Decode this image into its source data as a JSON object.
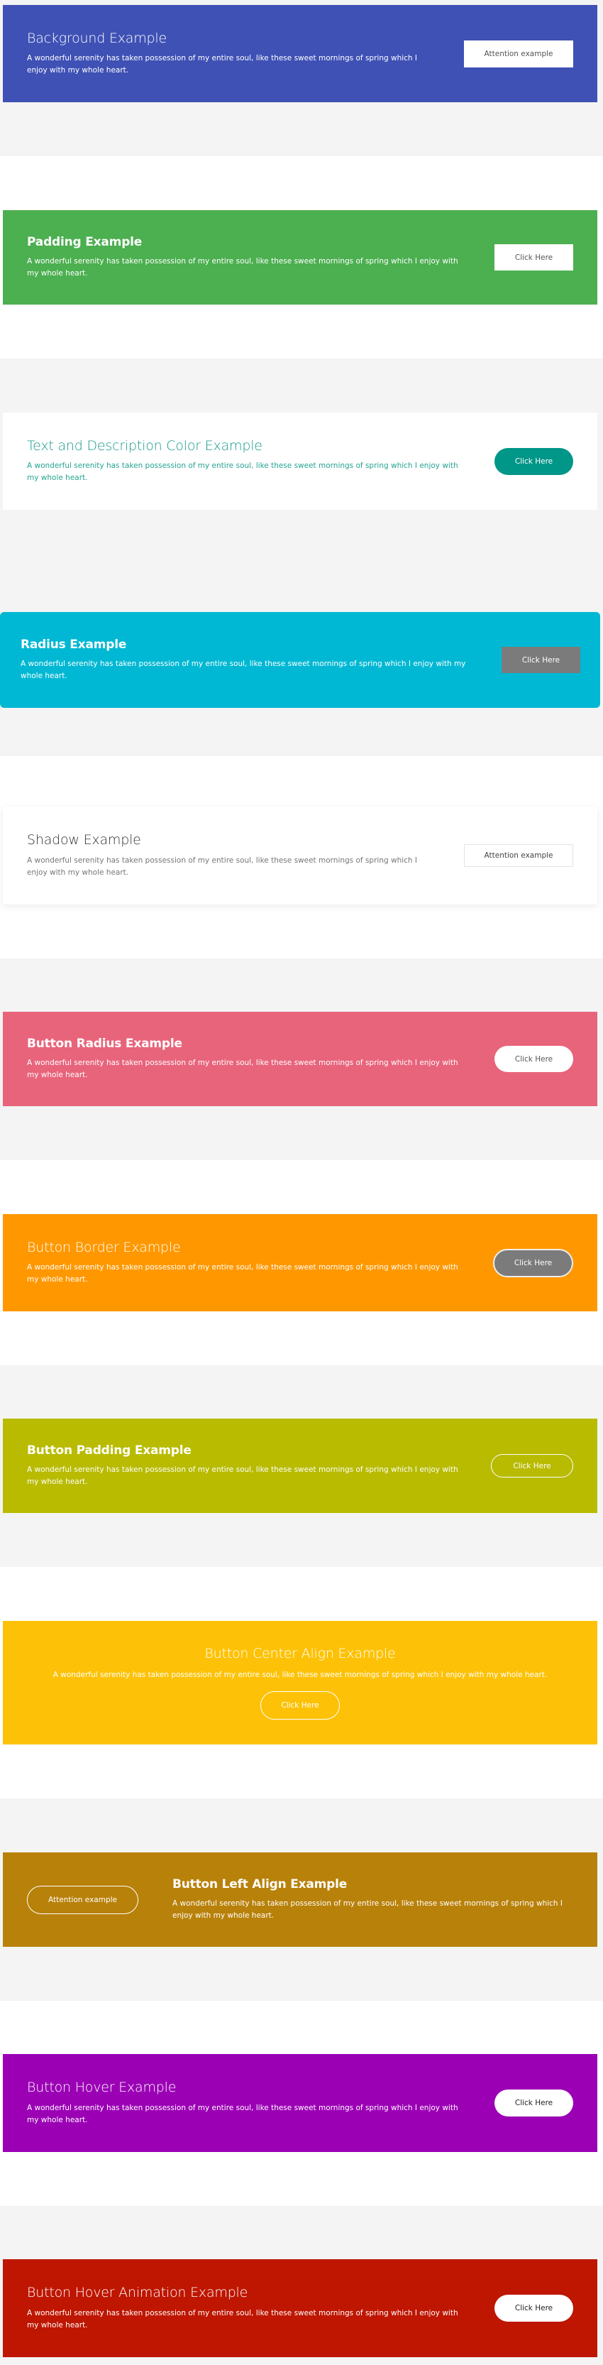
{
  "colors": {
    "page_gray": "#f4f4f4",
    "page_white": "#ffffff"
  },
  "sections": [
    {
      "title": "Background Example",
      "description": "A wonderful serenity has taken possession of my entire soul, like these sweet mornings of spring which I enjoy with my whole heart.",
      "button": "Attention example",
      "bg_color": "#3f51b5"
    },
    {
      "title": "Padding Example",
      "description": "A wonderful serenity has taken possession of my entire soul, like these sweet mornings of spring which I enjoy with my whole heart.",
      "button": "Click Here",
      "bg_color": "#4caf50"
    },
    {
      "title": "Text and Description Color Example",
      "description": "A wonderful serenity has taken possession of my entire soul, like these sweet mornings of spring which I enjoy with my whole heart.",
      "button": "Click Here",
      "bg_color": "#ffffff",
      "text_color": "#179a8a",
      "button_color": "#009688"
    },
    {
      "title": "Radius Example",
      "description": "A wonderful serenity has taken possession of my entire soul, like these sweet mornings of spring which I enjoy with my whole heart.",
      "button": "Click Here",
      "bg_color": "#00b8d4",
      "button_color": "#7b7b7b"
    },
    {
      "title": "Shadow Example",
      "description": "A wonderful serenity has taken possession of my entire soul, like these sweet mornings of spring which I enjoy with my whole heart.",
      "button": "Attention example",
      "bg_color": "#ffffff"
    },
    {
      "title": "Button Radius Example",
      "description": "A wonderful serenity has taken possession of my entire soul, like these sweet mornings of spring which I enjoy with my whole heart.",
      "button": "Click Here",
      "bg_color": "#e8647b"
    },
    {
      "title": "Button Border Example",
      "description": "A wonderful serenity has taken possession of my entire soul, like these sweet mornings of spring which I enjoy with my whole heart.",
      "button": "Click Here",
      "bg_color": "#ff9800",
      "button_color": "#7b7b7b"
    },
    {
      "title": "Button Padding Example",
      "description": "A wonderful serenity has taken possession of my entire soul, like these sweet mornings of spring which I enjoy with my whole heart.",
      "button": "Click Here",
      "bg_color": "#b8bb00"
    },
    {
      "title": "Button Center Align Example",
      "description": "A wonderful serenity has taken possession of my entire soul, like these sweet mornings of spring which I enjoy with my whole heart.",
      "button": "Click Here",
      "bg_color": "#fdc207"
    },
    {
      "title": "Button Left Align Example",
      "description": "A wonderful serenity has taken possession of my entire soul, like these sweet mornings of spring which I enjoy with my whole heart.",
      "button": "Attention example",
      "bg_color": "#b8810a"
    },
    {
      "title": "Button Hover Example",
      "description": "A wonderful serenity has taken possession of my entire soul, like these sweet mornings of spring which I enjoy with my whole heart.",
      "button": "Click Here",
      "bg_color": "#9b00b5"
    },
    {
      "title": "Button Hover Animation Example",
      "description": "A wonderful serenity has taken possession of my entire soul, like these sweet mornings of spring which I enjoy with my whole heart.",
      "button": "Click Here",
      "bg_color": "#be1601"
    }
  ]
}
